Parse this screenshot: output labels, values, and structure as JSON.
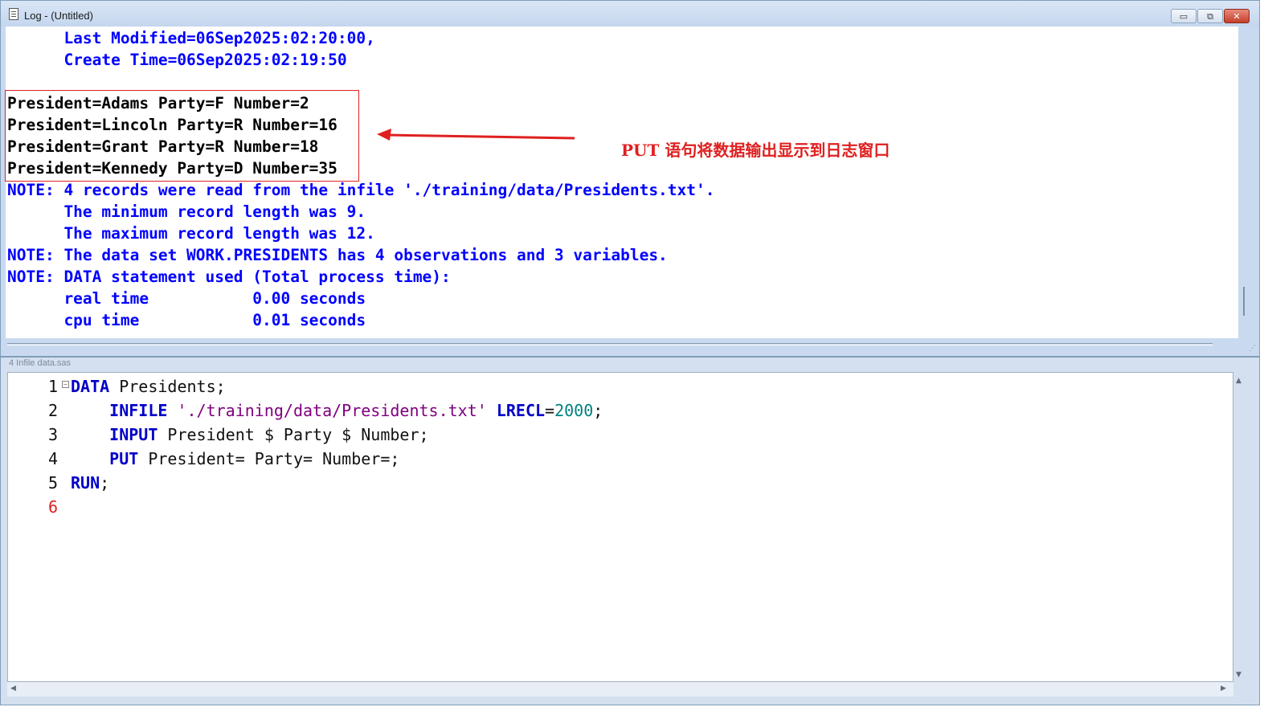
{
  "log_window": {
    "title": "Log - (Untitled)",
    "buttons": {
      "minimize": "▭",
      "restore": "⧉",
      "close": "✕"
    },
    "lines": [
      "      Last Modified=06Sep2025:02:20:00,",
      "      Create Time=06Sep2025:02:19:50",
      "",
      "President=Adams Party=F Number=2",
      "President=Lincoln Party=R Number=16",
      "President=Grant Party=R Number=18",
      "President=Kennedy Party=D Number=35",
      "NOTE: 4 records were read from the infile './training/data/Presidents.txt'.",
      "      The minimum record length was 9.",
      "      The maximum record length was 12.",
      "NOTE: The data set WORK.PRESIDENTS has 4 observations and 3 variables.",
      "NOTE: DATA statement used (Total process time):",
      "      real time           0.00 seconds",
      "      cpu time            0.01 seconds"
    ],
    "annotation": {
      "text": "PUT 语句将数据输出显示到日志窗口",
      "color": "#e02020"
    }
  },
  "editor_window": {
    "title": "4 Infile data.sas",
    "lines": [
      {
        "num": "1",
        "tokens": [
          {
            "t": "DATA",
            "c": "kw"
          },
          {
            "t": " Presidents;",
            "c": ""
          }
        ]
      },
      {
        "num": "2",
        "tokens": [
          {
            "t": "    ",
            "c": ""
          },
          {
            "t": "INFILE",
            "c": "kw"
          },
          {
            "t": " ",
            "c": ""
          },
          {
            "t": "'./training/data/Presidents.txt'",
            "c": "str"
          },
          {
            "t": " ",
            "c": ""
          },
          {
            "t": "LRECL",
            "c": "kw"
          },
          {
            "t": "=",
            "c": ""
          },
          {
            "t": "2000",
            "c": "num"
          },
          {
            "t": ";",
            "c": ""
          }
        ]
      },
      {
        "num": "3",
        "tokens": [
          {
            "t": "    ",
            "c": ""
          },
          {
            "t": "INPUT",
            "c": "kw"
          },
          {
            "t": " President $ Party $ Number;",
            "c": ""
          }
        ]
      },
      {
        "num": "4",
        "tokens": [
          {
            "t": "    ",
            "c": ""
          },
          {
            "t": "PUT",
            "c": "kw"
          },
          {
            "t": " President= Party= Number=;",
            "c": ""
          }
        ]
      },
      {
        "num": "5",
        "tokens": [
          {
            "t": "RUN",
            "c": "kw"
          },
          {
            "t": ";",
            "c": ""
          }
        ]
      },
      {
        "num": "6",
        "tokens": []
      }
    ],
    "current_line": "6"
  },
  "colors": {
    "log_note": "#0000ff",
    "log_put_output": "#000000",
    "keyword": "#0000c8",
    "string": "#800080",
    "number": "#008080",
    "annotation_red": "#e02020"
  },
  "icons": {
    "log_window": "document-icon",
    "fold": "collapse-minus-icon"
  }
}
